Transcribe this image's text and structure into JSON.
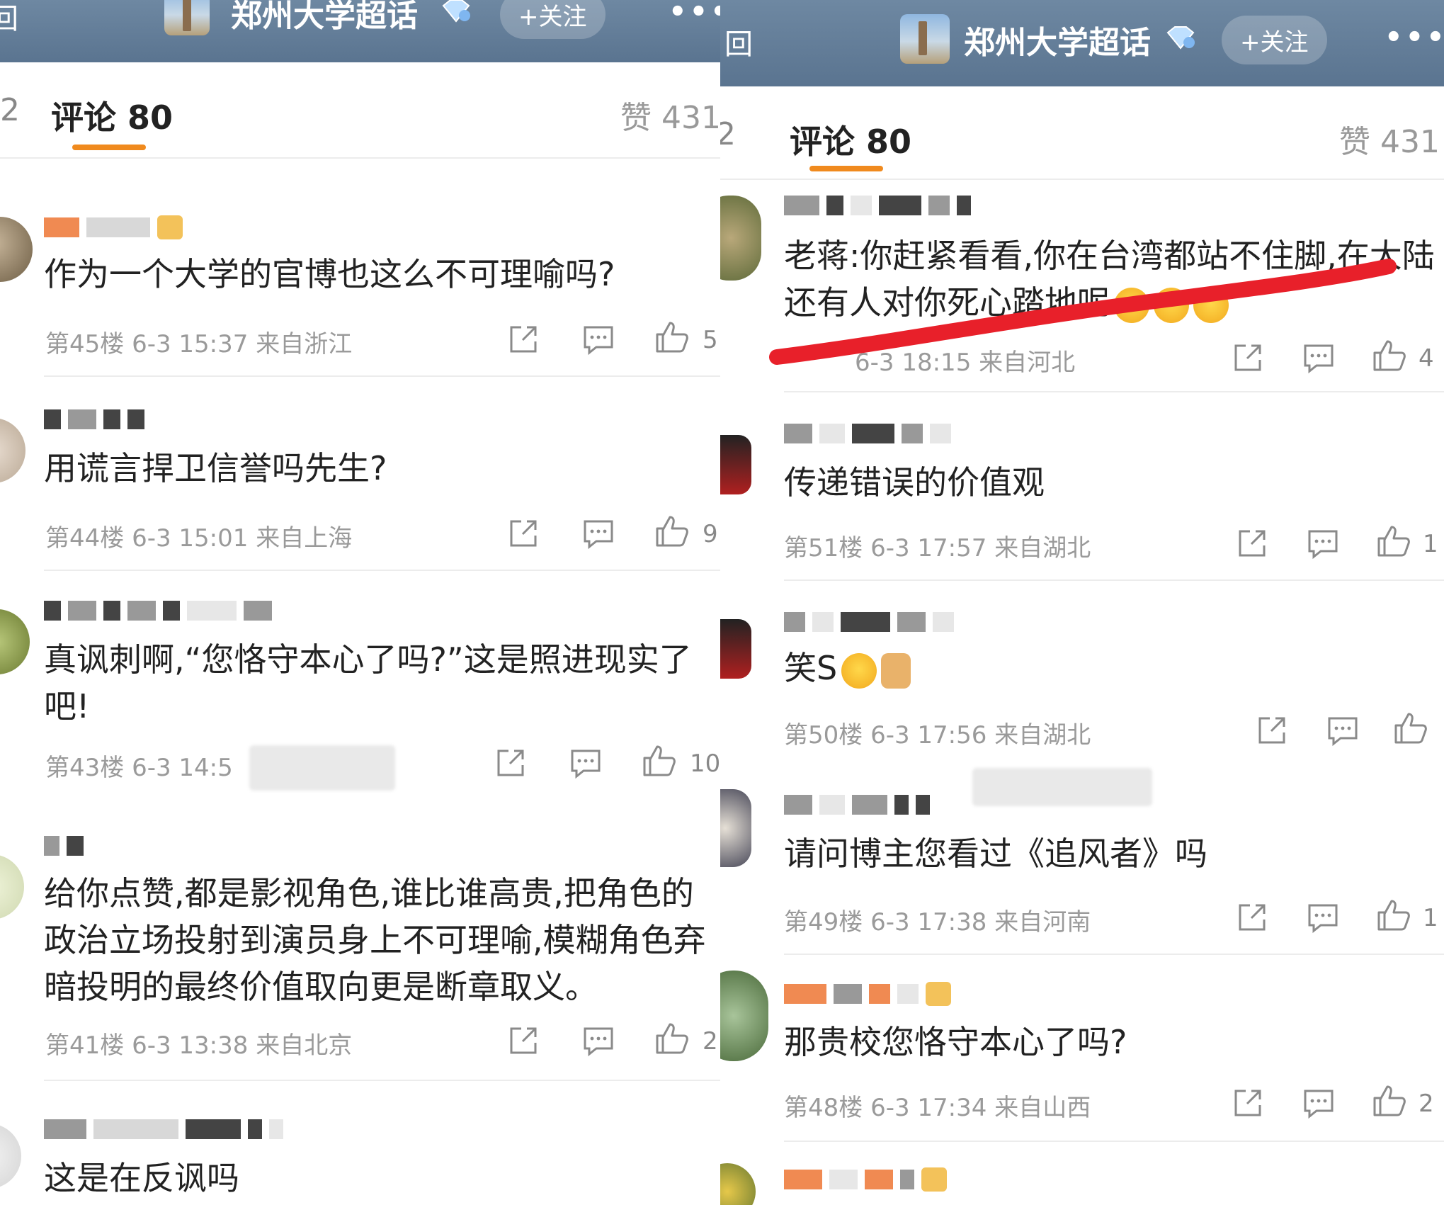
{
  "header": {
    "back_icon": "回",
    "title": "郑州大学超话",
    "follow_label": "+关注",
    "more_label": "•••"
  },
  "tabs": {
    "prev_count": "2",
    "comments_label": "评论 80",
    "likes_label": "赞 431"
  },
  "left_comments": [
    {
      "text": "作为一个大学的官博也这么不可理喻吗?",
      "floor": "第45楼",
      "date": "6-3 15:37",
      "location": "来自浙江",
      "likes": "5"
    },
    {
      "text": "用谎言捍卫信誉吗先生?",
      "floor": "第44楼",
      "date": "6-3 15:01",
      "location": "来自上海",
      "likes": "9"
    },
    {
      "text": "真讽刺啊,“您恪守本心了吗?”这是照进现实了吧!",
      "floor": "第43楼",
      "date": "6-3 14:5",
      "location": "",
      "likes": "10"
    },
    {
      "text": "给你点赞,都是影视角色,谁比谁高贵,把角色的政治立场投射到演员身上不可理喻,模糊角色弃暗投明的最终价值取向更是断章取义。",
      "floor": "第41楼",
      "date": "6-3 13:38",
      "location": "来自北京",
      "likes": "2"
    },
    {
      "text": "这是在反讽吗"
    }
  ],
  "right_comments": [
    {
      "text": "老蒋:你赶紧看看,你在台湾都站不住脚,在大陆还有人对你死心踏地呢",
      "date": "6-3 18:15",
      "location": "来自河北",
      "likes": "4"
    },
    {
      "text": "传递错误的价值观",
      "floor": "第51楼",
      "date": "6-3 17:57",
      "location": "来自湖北",
      "likes": "1"
    },
    {
      "text": "笑S",
      "floor": "第50楼",
      "date": "6-3 17:56",
      "location": "来自湖北",
      "likes": ""
    },
    {
      "text": "请问博主您看过《追风者》吗",
      "floor": "第49楼",
      "date": "6-3 17:38",
      "location": "来自河南",
      "likes": "1"
    },
    {
      "text": "那贵校您恪守本心了吗?",
      "floor": "第48楼",
      "date": "6-3 17:34",
      "location": "来自山西",
      "likes": "2"
    }
  ],
  "colors": {
    "header_bg": "#5a7490",
    "tab_underline": "#f08a1e",
    "annotation_red": "#e8202a",
    "meta_text": "#9a9a9a"
  }
}
